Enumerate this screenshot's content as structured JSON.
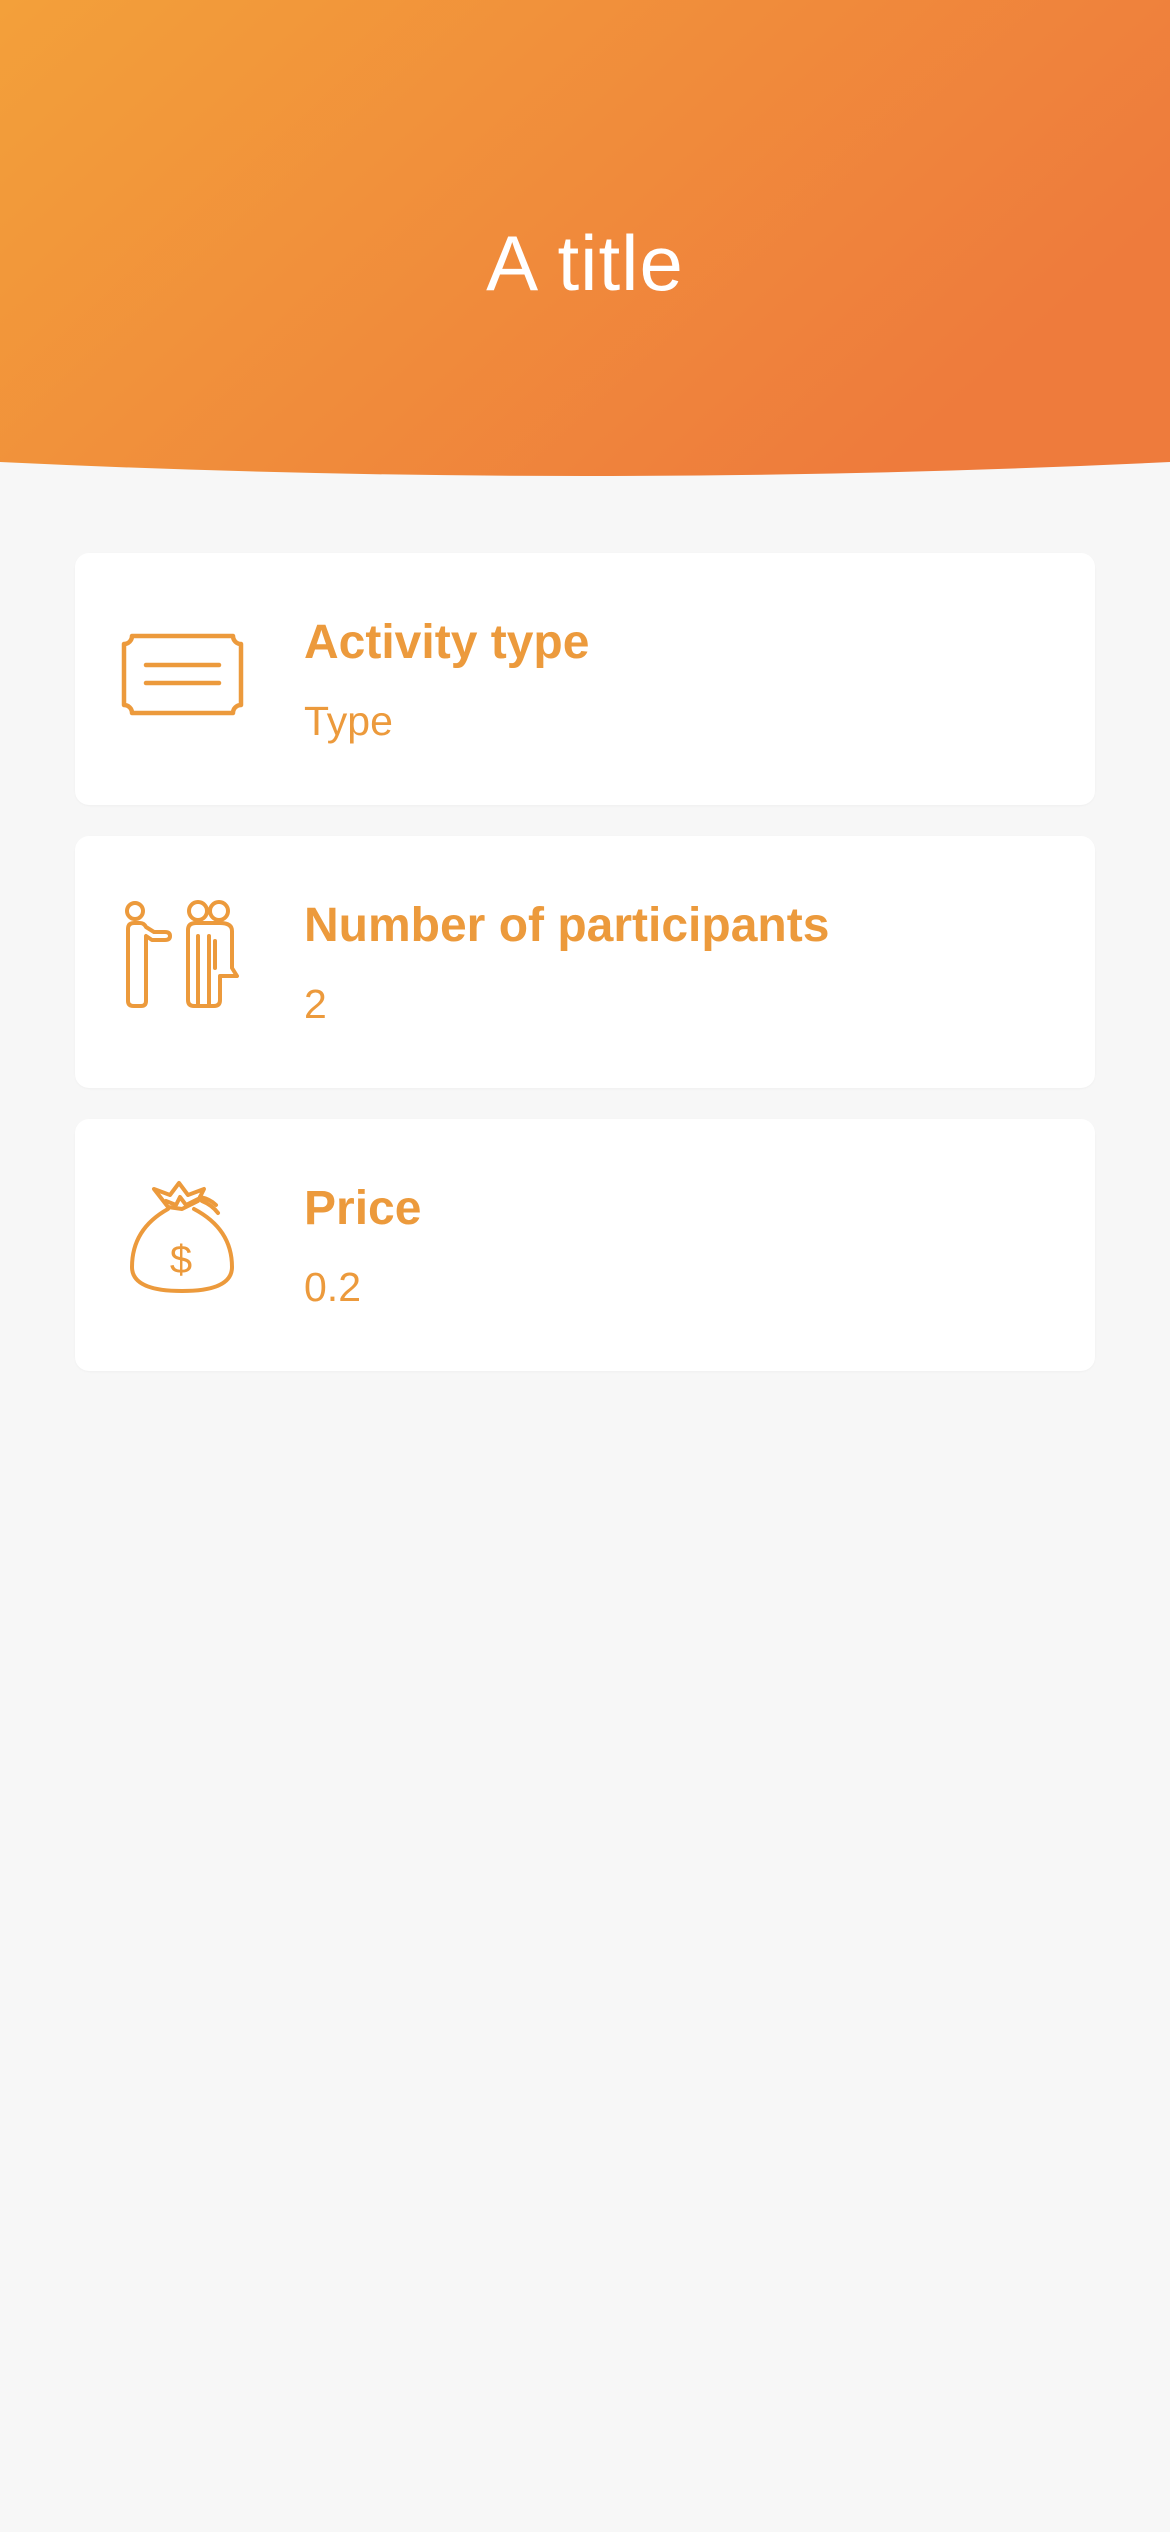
{
  "header": {
    "title": "A title",
    "gradient_start": "#f3a03a",
    "gradient_end": "#ee7b3c"
  },
  "accent_color": "#ec9a3c",
  "cards": [
    {
      "icon": "ticket-icon",
      "title": "Activity type",
      "value": "Type"
    },
    {
      "icon": "participants-icon",
      "title": "Number of participants",
      "value": "2"
    },
    {
      "icon": "money-bag-icon",
      "title": "Price",
      "value": "0.2"
    }
  ]
}
